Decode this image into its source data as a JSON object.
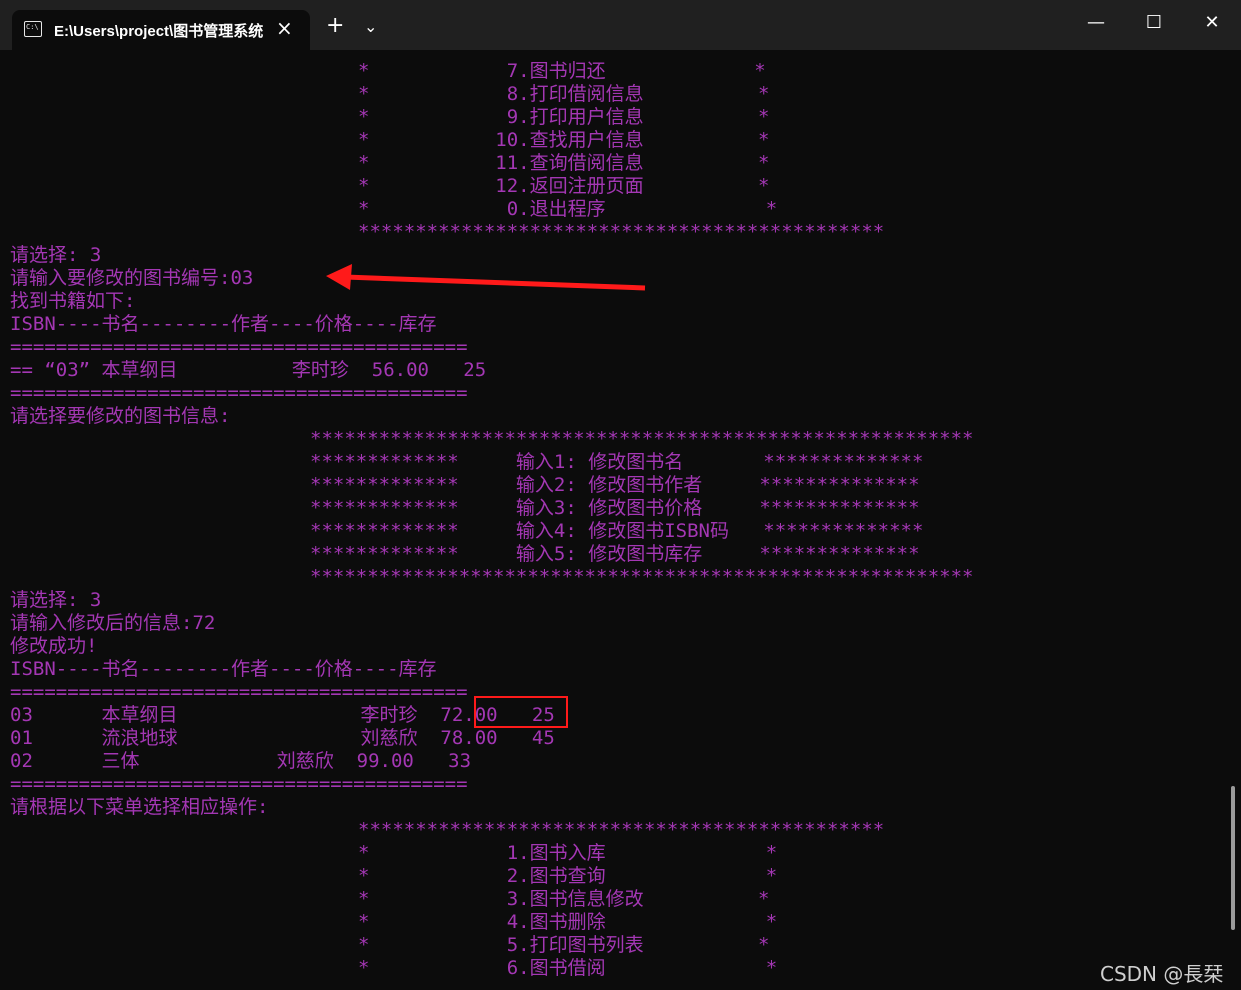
{
  "window": {
    "tab_title": "E:\\Users\\project\\图书管理系统",
    "icons": {
      "terminal": "terminal-icon",
      "close": "close-icon",
      "new_tab": "plus-icon",
      "dropdown": "chevron-down-icon",
      "minimize": "minimize-icon",
      "maximize": "maximize-icon",
      "window_close": "window-close-icon"
    }
  },
  "terminal": {
    "text_color": "#a437b4",
    "lines": [
      "        *            7.图书归还             *",
      "        *            8.打印借阅信息          *",
      "        *            9.打印用户信息          *",
      "        *           10.查找用户信息          *",
      "        *           11.查询借阅信息          *",
      "        *           12.返回注册页面          *",
      "        *            0.退出程序              *",
      "        **********************************************",
      "请选择: 3",
      "请输入要修改的图书编号:03",
      "找到书籍如下:",
      "ISBN----书名--------作者----价格----库存",
      "========================================",
      "== “03” 本草纲目          李时珍  56.00   25",
      "========================================",
      "请选择要修改的图书信息:",
      "**********************************************************",
      "*************     输入1: 修改图书名       **************",
      "*************     输入2: 修改图书作者     **************",
      "*************     输入3: 修改图书价格     **************",
      "*************     输入4: 修改图书ISBN码   **************",
      "*************     输入5: 修改图书库存     **************",
      "**********************************************************",
      "请选择: 3",
      "请输入修改后的信息:72",
      "修改成功!",
      "ISBN----书名--------作者----价格----库存",
      "========================================",
      "03      本草纲目                李时珍  72.00   25",
      "01      流浪地球                刘慈欣  78.00   45",
      "02      三体            刘慈欣  99.00   33",
      "========================================",
      "请根据以下菜单选择相应操作:",
      "**********************************************",
      "        *            1.图书入库              *",
      "        *            2.图书查询              *",
      "        *            3.图书信息修改          *",
      "        *            4.图书删除              *",
      "        *            5.打印图书列表          *",
      "        *            6.图书借阅              *"
    ]
  },
  "annotations": {
    "arrow_color": "#ff1a1a",
    "box_color": "#ff1a1a"
  },
  "watermark": "CSDN @長栞"
}
